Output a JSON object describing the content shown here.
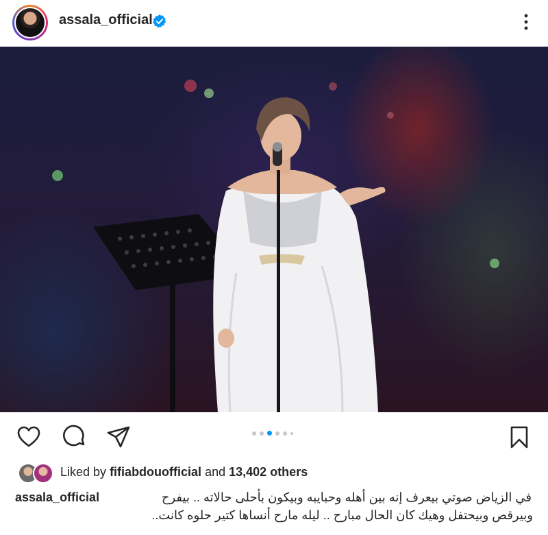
{
  "post": {
    "username": "assala_official",
    "verified": true,
    "verified_color": "#0095f6",
    "avatar_icon": "profile-avatar",
    "more_icon": "more-vertical-icon"
  },
  "photo": {
    "alt_subject": "singer-on-stage"
  },
  "actions": {
    "like_icon": "heart-icon",
    "comment_icon": "comment-icon",
    "share_icon": "share-icon",
    "save_icon": "bookmark-icon",
    "carousel_total": 6,
    "carousel_active": 3
  },
  "likes": {
    "prefix": "Liked by",
    "liker": "fifiabdouofficial",
    "connector": "and",
    "count": "13,402 others"
  },
  "caption": {
    "username": "assala_official",
    "line1": "في الزياض صوتي بيعرف إنه بين أهله وحبايبه وبيكون بأحلى حالاته .. بيفرح",
    "line2": "وبيرقص وبيحتفل وهيك كان الحال مبارح .. ليله مارح أنساها كتير حلوه كانت.."
  },
  "colors": {
    "text": "#262626",
    "accent": "#0095f6",
    "dot_inactive": "#c7c7c7"
  }
}
